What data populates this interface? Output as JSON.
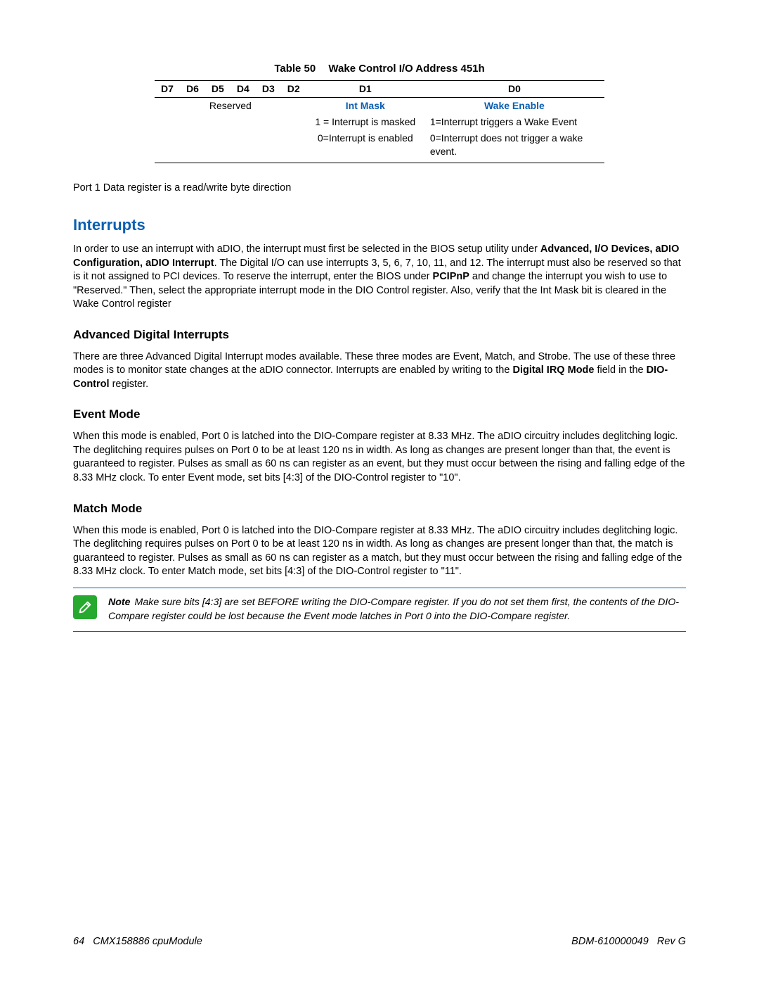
{
  "table": {
    "caption_num": "Table 50",
    "caption_title": "Wake Control I/O Address 451h",
    "headers": [
      "D7",
      "D6",
      "D5",
      "D4",
      "D3",
      "D2",
      "D1",
      "D0"
    ],
    "row1": {
      "reserved": "Reserved",
      "d1": "Int Mask",
      "d0": "Wake Enable"
    },
    "row2": {
      "d1": "1 = Interrupt is masked",
      "d0": "1=Interrupt triggers a Wake Event"
    },
    "row3": {
      "d1": "0=Interrupt is enabled",
      "d0": "0=Interrupt does not trigger a wake event."
    }
  },
  "p_port1": "Port 1 Data register is a read/write byte direction",
  "h_interrupts": "Interrupts",
  "p_interrupts_a": "In order to use an interrupt with aDIO, the interrupt must first be selected in the BIOS setup utility under ",
  "p_interrupts_b_bold": "Advanced, I/O Devices, aDIO Configuration, aDIO Interrupt",
  "p_interrupts_c": ". The Digital I/O can use interrupts 3, 5, 6, 7, 10, 11, and 12. The interrupt must also be reserved so that is it not assigned to PCI devices. To reserve the interrupt, enter the BIOS under ",
  "p_interrupts_d_bold": "PCIPnP",
  "p_interrupts_e": " and change the interrupt you wish to use to \"Reserved.\" Then, select the appropriate interrupt mode in the DIO Control register. Also, verify that the Int Mask bit is cleared in the Wake Control register",
  "h_adv": "Advanced Digital Interrupts",
  "p_adv_a": "There are three Advanced Digital Interrupt modes available. These three modes are Event, Match, and Strobe. The use of these three modes is to monitor state changes at the aDIO connector. Interrupts are enabled by writing to the ",
  "p_adv_b_bold": "Digital IRQ Mode",
  "p_adv_c": " field in the ",
  "p_adv_d_bold": "DIO-Control",
  "p_adv_e": " register.",
  "h_event": "Event Mode",
  "p_event": "When this mode is enabled, Port 0 is latched into the DIO-Compare register at 8.33 MHz. The aDIO circuitry includes deglitching logic. The deglitching requires pulses on Port 0 to be at least 120 ns in width. As long as changes are present longer than that, the event is guaranteed to register. Pulses as small as  60 ns can register as an event, but they must occur between the rising and falling edge of the 8.33 MHz clock. To enter Event mode, set bits [4:3] of the DIO-Control register to \"10\".",
  "h_match": "Match Mode",
  "p_match": "When this mode is enabled, Port 0 is latched into the DIO-Compare register at 8.33 MHz. The aDIO circuitry includes deglitching logic. The deglitching requires pulses on Port 0 to be at least 120 ns in width. As long as changes are present longer than that, the match is guaranteed to register. Pulses as small as 60 ns can register as a match, but they must occur between the rising and falling edge of the 8.33 MHz clock. To enter Match mode, set bits [4:3] of the DIO-Control register to \"11\".",
  "note": {
    "label": "Note",
    "text": "Make sure bits [4:3] are set BEFORE writing the DIO-Compare register. If you do not set them first, the contents of the DIO-Compare register could be lost because the Event mode latches in Port 0 into the DIO-Compare register."
  },
  "footer": {
    "page": "64",
    "left": "CMX158886 cpuModule",
    "right_doc": "BDM-610000049",
    "right_rev": "Rev G"
  }
}
